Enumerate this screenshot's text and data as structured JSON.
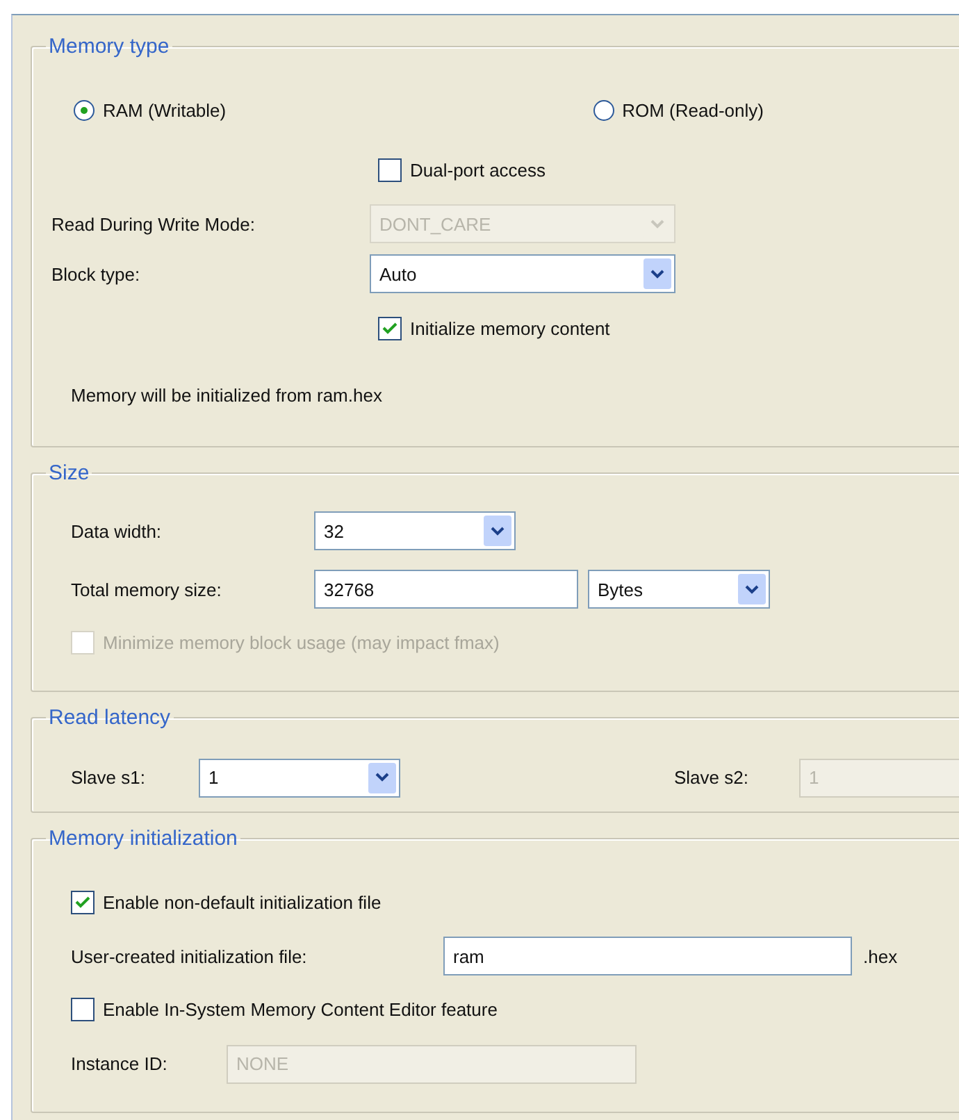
{
  "memory_type": {
    "legend": "Memory type",
    "radios": [
      {
        "label": "RAM (Writable)",
        "selected": true
      },
      {
        "label": "ROM (Read-only)",
        "selected": false
      }
    ],
    "dual_port": {
      "label": "Dual-port access",
      "checked": false,
      "disabled": false
    },
    "read_during_write": {
      "label": "Read During Write Mode:",
      "value": "DONT_CARE",
      "disabled": true
    },
    "block_type": {
      "label": "Block type:",
      "value": "Auto",
      "disabled": false
    },
    "initialize": {
      "label": "Initialize memory content",
      "checked": true,
      "disabled": false
    },
    "note": "Memory will be initialized from ram.hex"
  },
  "size": {
    "legend": "Size",
    "data_width": {
      "label": "Data width:",
      "value": "32",
      "disabled": false
    },
    "total_memory_size": {
      "label": "Total memory size:",
      "value": "32768",
      "disabled": false
    },
    "unit": {
      "value": "Bytes",
      "disabled": false
    },
    "minimize": {
      "label": "Minimize memory block usage (may impact fmax)",
      "checked": false,
      "disabled": true
    }
  },
  "read_latency": {
    "legend": "Read latency",
    "slave_s1": {
      "label": "Slave s1:",
      "value": "1",
      "disabled": false
    },
    "slave_s2": {
      "label": "Slave s2:",
      "value": "1",
      "disabled": true
    }
  },
  "memory_initialization": {
    "legend": "Memory initialization",
    "enable_non_default": {
      "label": "Enable non-default initialization file",
      "checked": true,
      "disabled": false
    },
    "user_file": {
      "label": "User-created initialization file:",
      "value": "ram",
      "suffix": ".hex",
      "disabled": false
    },
    "in_system_editor": {
      "label": "Enable In-System Memory Content Editor feature",
      "checked": false,
      "disabled": false
    },
    "instance_id": {
      "label": "Instance ID:",
      "value": "NONE",
      "disabled": true
    }
  }
}
